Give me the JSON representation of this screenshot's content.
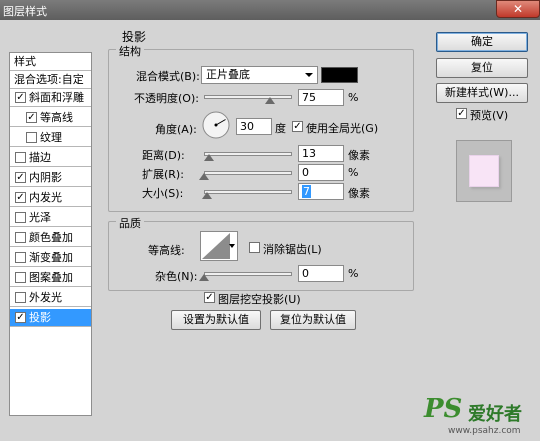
{
  "window": {
    "title": "图层样式",
    "close_label": "✕"
  },
  "style_list": {
    "header": "样式",
    "blend_options": "混合选项:自定",
    "items": [
      {
        "label": "斜面和浮雕",
        "checked": true,
        "indent": false,
        "selected": false
      },
      {
        "label": "等高线",
        "checked": true,
        "indent": true,
        "selected": false
      },
      {
        "label": "纹理",
        "checked": false,
        "indent": true,
        "selected": false
      },
      {
        "label": "描边",
        "checked": false,
        "indent": false,
        "selected": false
      },
      {
        "label": "内阴影",
        "checked": true,
        "indent": false,
        "selected": false
      },
      {
        "label": "内发光",
        "checked": true,
        "indent": false,
        "selected": false
      },
      {
        "label": "光泽",
        "checked": false,
        "indent": false,
        "selected": false
      },
      {
        "label": "颜色叠加",
        "checked": false,
        "indent": false,
        "selected": false
      },
      {
        "label": "渐变叠加",
        "checked": false,
        "indent": false,
        "selected": false
      },
      {
        "label": "图案叠加",
        "checked": false,
        "indent": false,
        "selected": false
      },
      {
        "label": "外发光",
        "checked": false,
        "indent": false,
        "selected": false
      },
      {
        "label": "投影",
        "checked": true,
        "indent": false,
        "selected": true
      }
    ]
  },
  "drop_shadow": {
    "section_title": "投影",
    "structure": {
      "legend": "结构",
      "blend_mode_label": "混合模式(B):",
      "blend_mode_value": "正片叠底",
      "shadow_color": "#000000",
      "opacity_label": "不透明度(O):",
      "opacity_value": "75",
      "opacity_unit": "%",
      "opacity_level": 0.75,
      "angle_label": "角度(A):",
      "angle_value": "30",
      "angle_unit": "度",
      "global_light_label": "使用全局光(G)",
      "global_light_checked": true,
      "distance_label": "距离(D):",
      "distance_value": "13",
      "distance_unit": "像素",
      "distance_level": 0.06,
      "spread_label": "扩展(R):",
      "spread_value": "0",
      "spread_unit": "%",
      "spread_level": 0.0,
      "size_label": "大小(S):",
      "size_value": "7",
      "size_unit": "像素",
      "size_level": 0.03
    },
    "quality": {
      "legend": "品质",
      "contour_label": "等高线:",
      "antialias_label": "消除锯齿(L)",
      "antialias_checked": false,
      "noise_label": "杂色(N):",
      "noise_value": "0",
      "noise_unit": "%",
      "noise_level": 0.0
    },
    "knockout_label": "图层挖空投影(U)",
    "knockout_checked": true,
    "make_default_label": "设置为默认值",
    "reset_default_label": "复位为默认值"
  },
  "buttons": {
    "ok": "确定",
    "reset": "复位",
    "new_style": "新建样式(W)...",
    "preview_label": "预览(V)",
    "preview_checked": true
  },
  "watermark": {
    "brand": "PS",
    "text": "爱好者",
    "url": "www.psahz.com"
  },
  "colors": {
    "accent": "#3399ff",
    "preview_fill": "#f8e4f6"
  }
}
